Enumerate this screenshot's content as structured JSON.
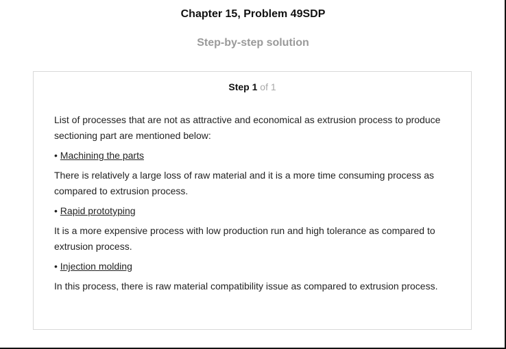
{
  "header": {
    "title": "Chapter 15, Problem 49SDP",
    "subtitle": "Step-by-step solution"
  },
  "step": {
    "word": "Step",
    "number": "1",
    "of_text": "of 1"
  },
  "content": {
    "intro": "List of processes that are not as attractive and economical as extrusion process to produce sectioning part are mentioned below:",
    "bullet_symbol": "•",
    "items": [
      {
        "term": "Machining the parts",
        "description": "There is relatively a large loss of raw material and it is a more time consuming process as compared to extrusion process."
      },
      {
        "term": "Rapid prototyping",
        "description": "It is a more expensive process with low production run and high tolerance as compared to extrusion process."
      },
      {
        "term": "Injection molding",
        "description": "In this process, there is raw material compatibility issue as compared to extrusion process."
      }
    ]
  }
}
